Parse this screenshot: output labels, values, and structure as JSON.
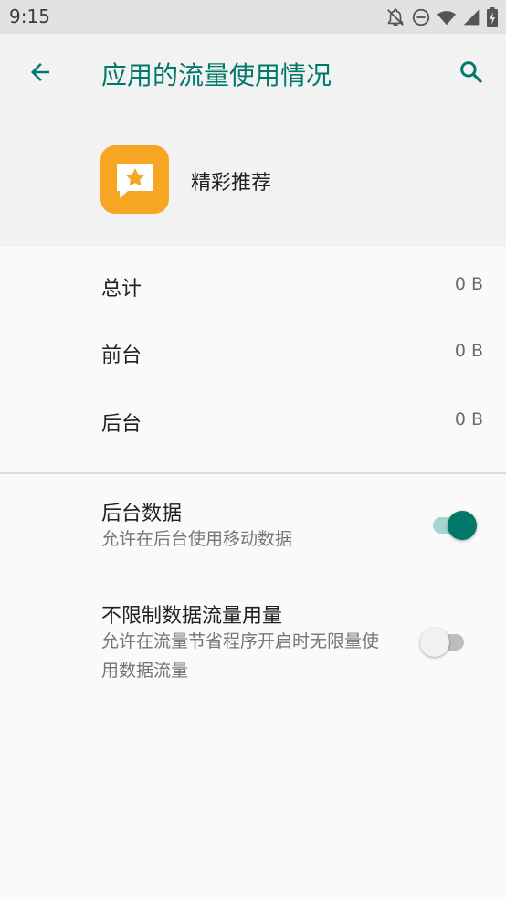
{
  "status_bar": {
    "time": "9:15"
  },
  "header": {
    "title": "应用的流量使用情况"
  },
  "app": {
    "name": "精彩推荐"
  },
  "usage": [
    {
      "label": "总计",
      "value": "0 B"
    },
    {
      "label": "前台",
      "value": "0 B"
    },
    {
      "label": "后台",
      "value": "0 B"
    }
  ],
  "settings": [
    {
      "title": "后台数据",
      "subtitle": "允许在后台使用移动数据",
      "enabled": true
    },
    {
      "title": "不限制数据流量用量",
      "subtitle": "允许在流量节省程序开启时无限量使用数据流量",
      "enabled": false
    }
  ],
  "icons": {
    "back": "arrow-back-icon",
    "search": "search-icon",
    "app": "star-chat-icon",
    "status": [
      "notifications-off-icon",
      "do-not-disturb-icon",
      "wifi-icon",
      "signal-icon",
      "battery-charging-icon"
    ]
  },
  "colors": {
    "accent": "#00796b",
    "app_icon": "#f6a623",
    "toggle_on_thumb": "#00796b",
    "toggle_on_track": "#a7d5d0",
    "toggle_off_thumb": "#f1f1f1",
    "toggle_off_track": "#bdbdbd"
  }
}
